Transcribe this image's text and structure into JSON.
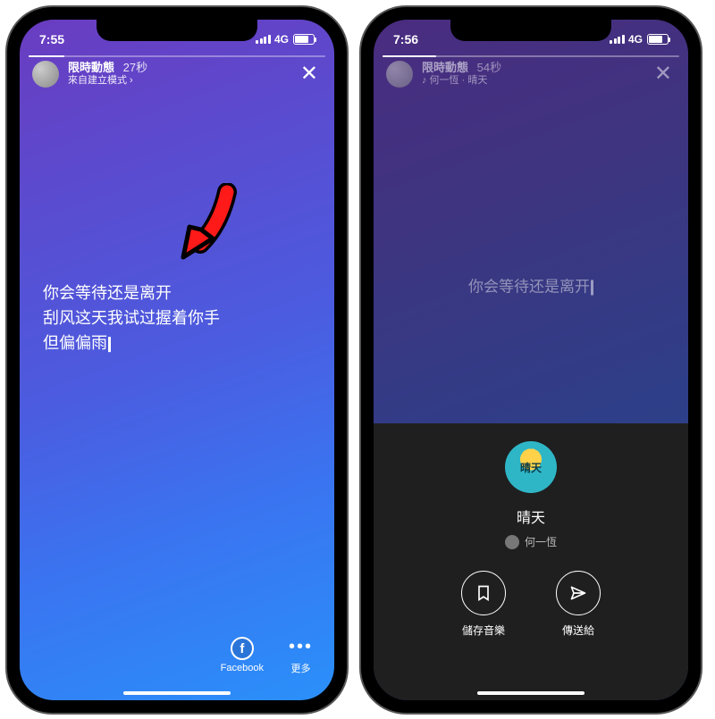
{
  "left": {
    "status": {
      "time": "7:55",
      "net": "4G"
    },
    "story": {
      "title": "限時動態",
      "secs": "27秒",
      "sub": "來自建立模式 ›"
    },
    "lyrics": {
      "l1": "你会等待还是离开",
      "l2": "刮风这天我试过握着你手",
      "l3": "但偏偏雨"
    },
    "bottom": {
      "fb_label": "Facebook",
      "more_label": "更多"
    }
  },
  "right": {
    "status": {
      "time": "7:56",
      "net": "4G"
    },
    "story": {
      "title": "限時動態",
      "secs": "54秒",
      "sub": "♪ 何一恆 · 晴天"
    },
    "lyrics": {
      "l1": "你会等待还是离开"
    },
    "sheet": {
      "album_label": "晴天",
      "song": "晴天",
      "artist": "何一恆",
      "save_label": "儲存音樂",
      "send_label": "傳送給"
    }
  }
}
